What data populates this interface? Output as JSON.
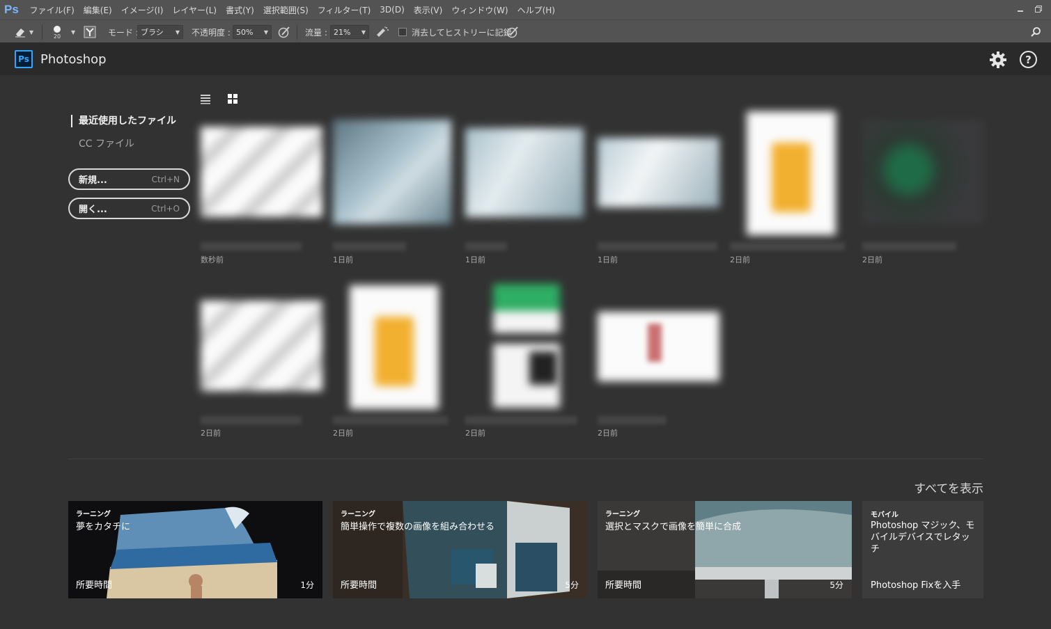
{
  "app": {
    "logo": "Ps",
    "title": "Photoshop",
    "badge": "Ps"
  },
  "menu": [
    "ファイル(F)",
    "編集(E)",
    "イメージ(I)",
    "レイヤー(L)",
    "書式(Y)",
    "選択範囲(S)",
    "フィルター(T)",
    "3D(D)",
    "表示(V)",
    "ウィンドウ(W)",
    "ヘルプ(H)"
  ],
  "options": {
    "brush_size": "20",
    "mode_label": "モード :",
    "mode_value": "ブラシ",
    "opacity_label": "不透明度 :",
    "opacity_value": "50%",
    "flow_label": "流量 :",
    "flow_value": "21%",
    "erase_history_label": "消去してヒストリーに記録"
  },
  "sidebar": {
    "recent": "最近使用したファイル",
    "cc": "CC ファイル",
    "new_label": "新規...",
    "new_shortcut": "Ctrl+N",
    "open_label": "開く...",
    "open_shortcut": "Ctrl+O"
  },
  "recent_files": [
    {
      "time": "数秒前"
    },
    {
      "time": "1日前"
    },
    {
      "time": "1日前"
    },
    {
      "time": "1日前"
    },
    {
      "time": "2日前"
    },
    {
      "time": "2日前"
    },
    {
      "time": "2日前"
    },
    {
      "time": "2日前"
    },
    {
      "time": "2日前"
    },
    {
      "time": "2日前"
    }
  ],
  "show_all": "すべてを表示",
  "cards": [
    {
      "tag": "ラーニング",
      "title": "夢をカタチに",
      "duration_label": "所要時間",
      "minutes": "1分"
    },
    {
      "tag": "ラーニング",
      "title": "簡単操作で複数の画像を組み合わせる",
      "duration_label": "所要時間",
      "minutes": "5分"
    },
    {
      "tag": "ラーニング",
      "title": "選択とマスクで画像を簡単に合成",
      "duration_label": "所要時間",
      "minutes": "5分"
    }
  ],
  "mobile_card": {
    "tag": "モバイル",
    "title": "Photoshop マジック、モバイルデバイスでレタッチ",
    "cta": "Photoshop Fixを入手"
  },
  "colors": {
    "accent": "#31a8ff",
    "background": "#323232",
    "bar": "#535353",
    "header": "#2a2a2a"
  }
}
